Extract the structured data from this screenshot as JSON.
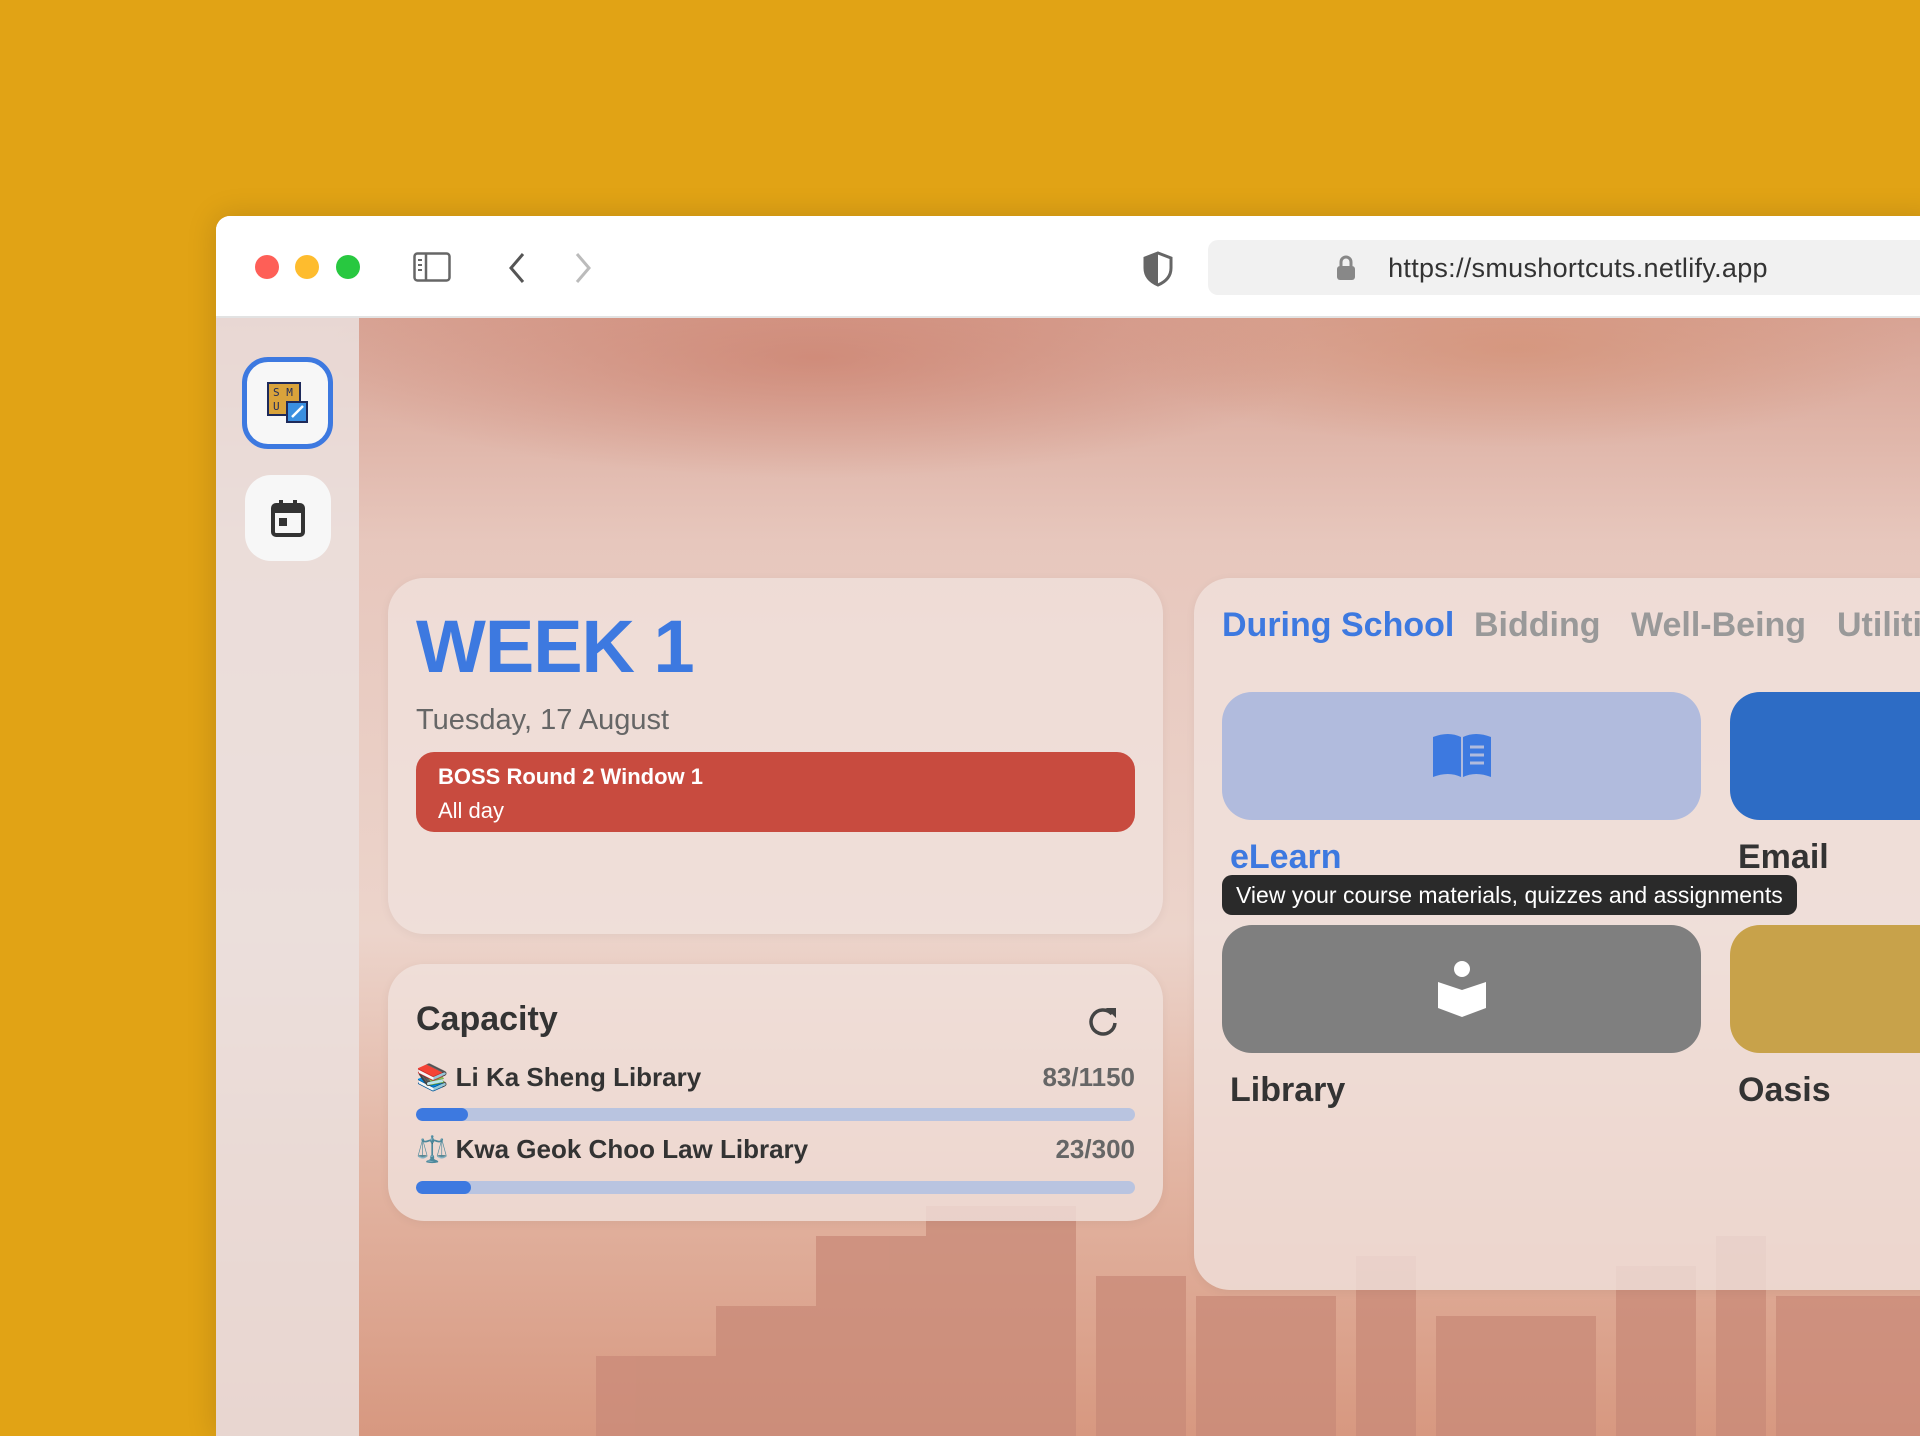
{
  "browser": {
    "url": "https://smushortcuts.netlify.app",
    "colors": {
      "close": "#fe5f57",
      "minimize": "#febc2e",
      "zoom": "#28c840"
    }
  },
  "sidebar": {
    "items": [
      {
        "name": "smu-shortcuts-logo",
        "logo_text": "SMU"
      },
      {
        "name": "calendar"
      }
    ]
  },
  "week_card": {
    "title": "WEEK 1",
    "date": "Tuesday, 17 August",
    "event": {
      "title": "BOSS Round 2 Window 1",
      "subtitle": "All day",
      "color": "#c84b3f"
    }
  },
  "capacity": {
    "title": "Capacity",
    "libraries": [
      {
        "icon": "📚",
        "name": "Li Ka Sheng Library",
        "value": "83/1150",
        "fraction": 0.072
      },
      {
        "icon": "⚖️",
        "name": "Kwa Geok Choo Law Library",
        "value": "23/300",
        "fraction": 0.077
      }
    ]
  },
  "shortcuts": {
    "tabs": [
      "During School",
      "Bidding",
      "Well-Being",
      "Utilities"
    ],
    "active_tab": 0,
    "tiles": [
      {
        "label": "eLearn",
        "color": "#b1bbdd",
        "icon": "book-icon"
      },
      {
        "label": "Email",
        "color": "#2d6cc5",
        "icon": ""
      },
      {
        "label": "Library",
        "color": "#7f7f7f",
        "icon": "reader-icon"
      },
      {
        "label": "Oasis",
        "color": "#c8a24a",
        "icon": ""
      }
    ],
    "tooltip": "View your course materials, quizzes and assignments"
  }
}
